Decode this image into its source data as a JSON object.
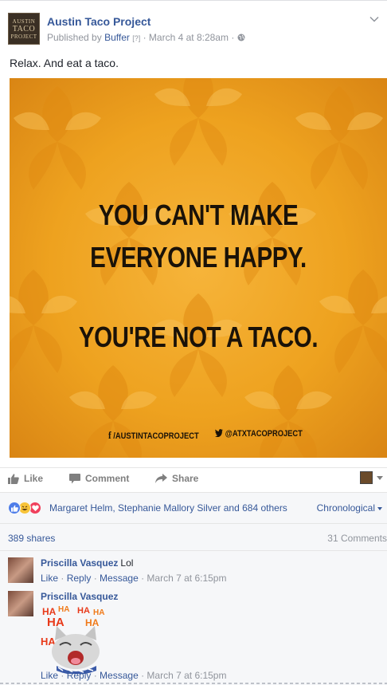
{
  "post": {
    "page_name": "Austin Taco Project",
    "logo_text": [
      "AUSTIN",
      "TACO",
      "PROJECT"
    ],
    "meta_prefix": "Published by",
    "meta_publisher": "Buffer",
    "meta_help": "[?]",
    "meta_sep": "·",
    "meta_date": "March 4 at 8:28am",
    "meta_sep2": "·",
    "caption": "Relax. And eat a taco.",
    "image": {
      "line1": "YOU CAN'T MAKE",
      "line2": "EVERYONE HAPPY.",
      "line3": "YOU'RE NOT A TACO.",
      "facebook": "/AUSTINTACOPROJECT",
      "twitter": "@ATXTACOPROJECT"
    }
  },
  "actions": {
    "like": "Like",
    "comment": "Comment",
    "share": "Share"
  },
  "reactions": {
    "names": "Margaret Helm, Stephanie Mallory Silver and 684 others",
    "order": "Chronological",
    "shares": "389 shares",
    "comments": "31 Comments"
  },
  "comments": [
    {
      "author": "Priscilla Vasquez",
      "text": "Lol",
      "like": "Like",
      "reply": "Reply",
      "message": "Message",
      "time": "March 7 at 6:15pm"
    },
    {
      "author": "Priscilla Vasquez",
      "text": "",
      "sticker_text": "HA",
      "like": "Like",
      "reply": "Reply",
      "message": "Message",
      "time": "March 7 at 6:15pm"
    }
  ],
  "colors": {
    "link": "#365899",
    "muted": "#90949c",
    "image_orange": "#eea21f"
  }
}
